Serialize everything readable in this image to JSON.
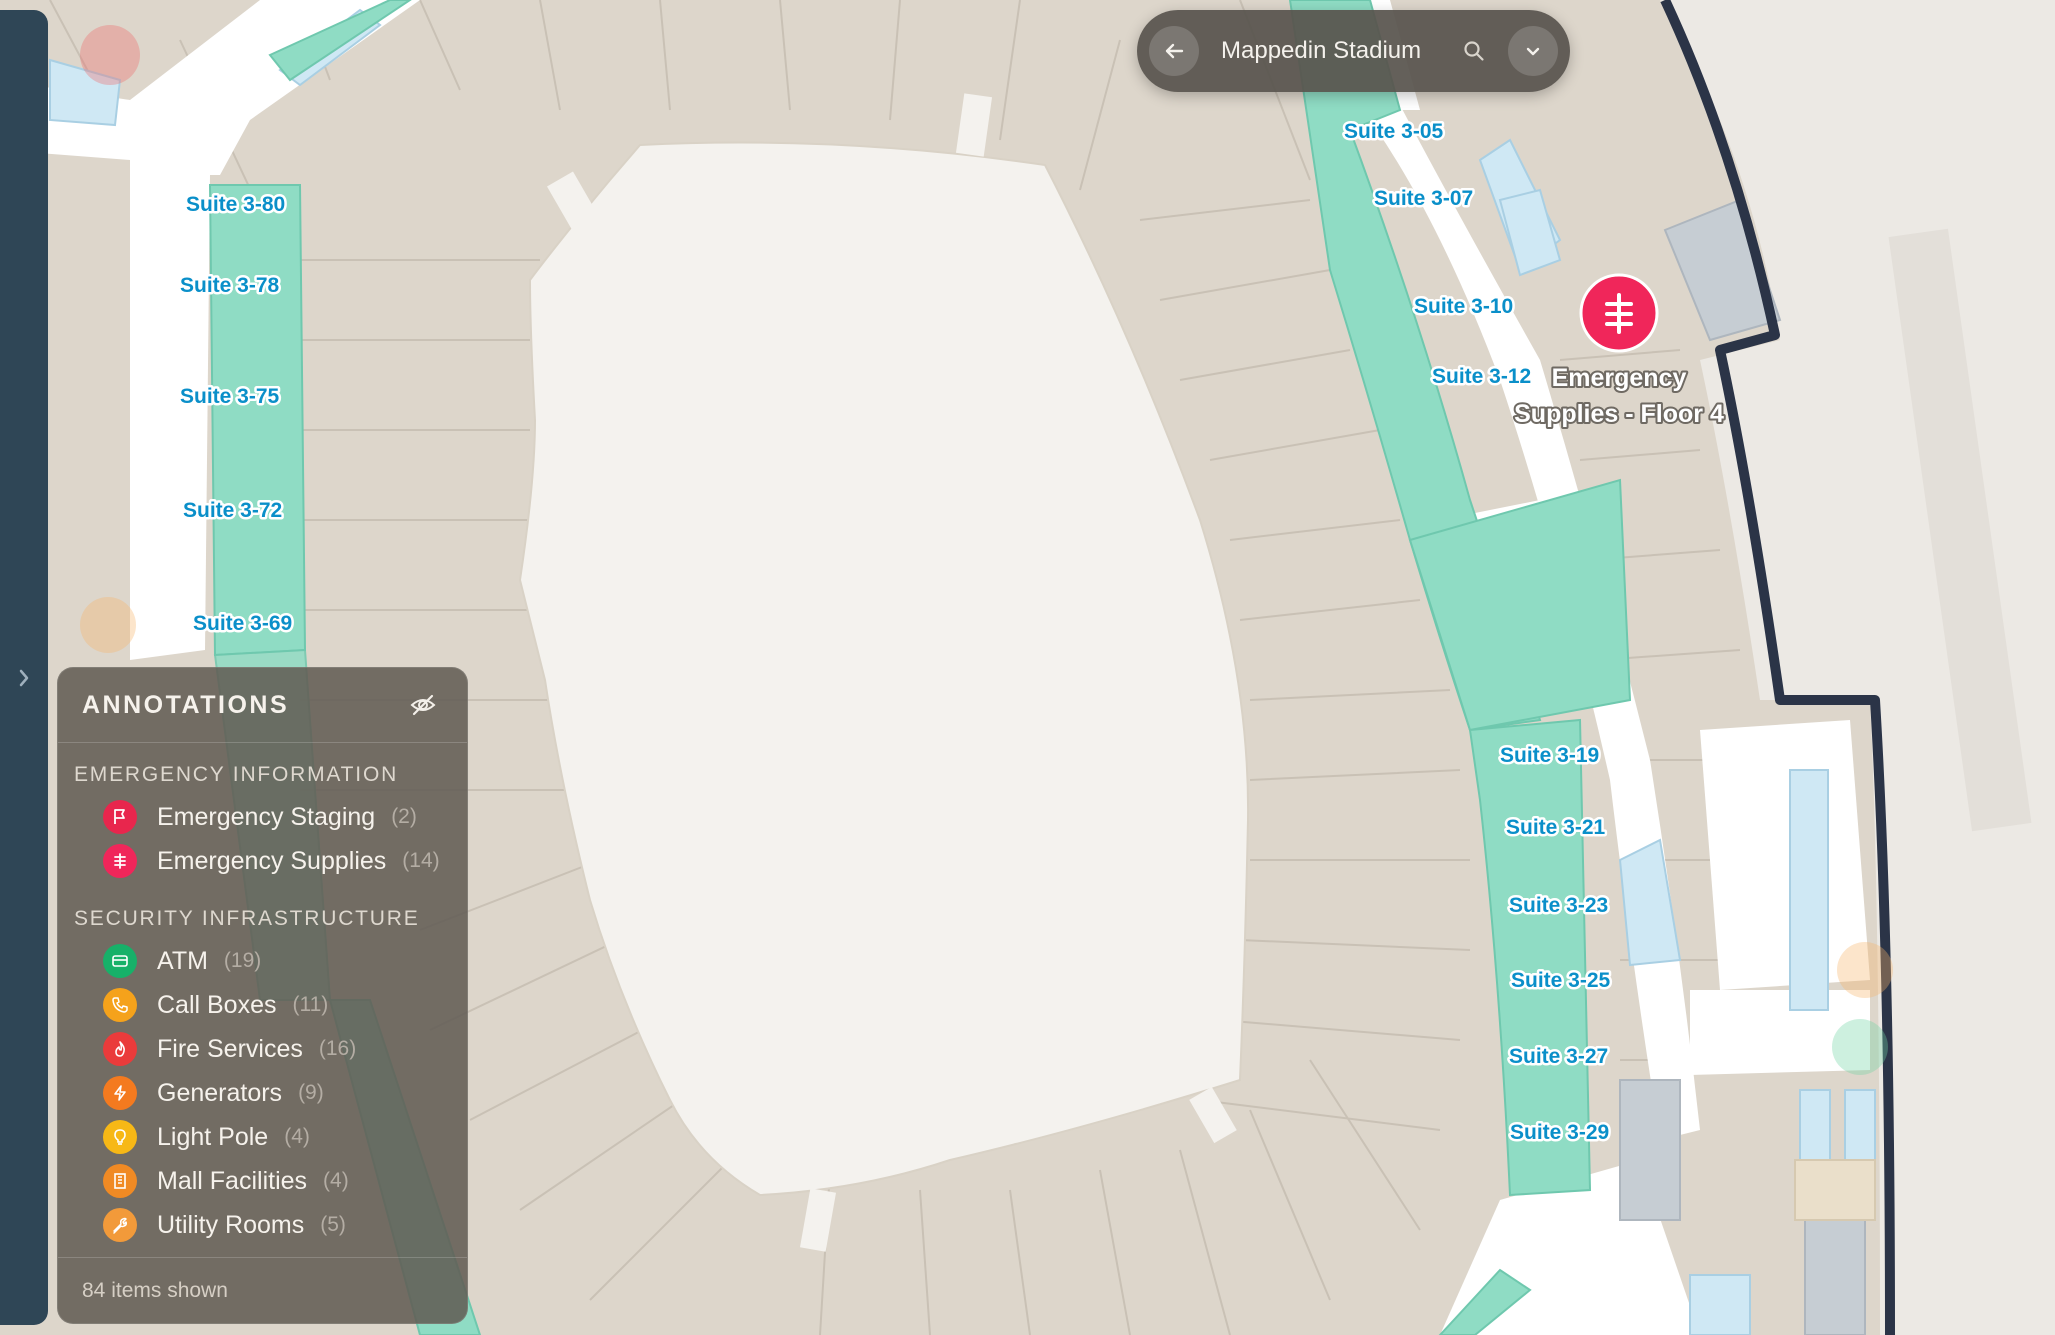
{
  "map": {
    "suites": [
      {
        "id": "s-3-80",
        "label": "Suite 3-80"
      },
      {
        "id": "s-3-78",
        "label": "Suite 3-78"
      },
      {
        "id": "s-3-75",
        "label": "Suite 3-75"
      },
      {
        "id": "s-3-72",
        "label": "Suite 3-72"
      },
      {
        "id": "s-3-69",
        "label": "Suite 3-69"
      },
      {
        "id": "s-3-05",
        "label": "Suite 3-05"
      },
      {
        "id": "s-3-07",
        "label": "Suite 3-07"
      },
      {
        "id": "s-3-10",
        "label": "Suite 3-10"
      },
      {
        "id": "s-3-12",
        "label": "Suite 3-12"
      },
      {
        "id": "s-3-19",
        "label": "Suite 3-19"
      },
      {
        "id": "s-3-21",
        "label": "Suite 3-21"
      },
      {
        "id": "s-3-23",
        "label": "Suite 3-23"
      },
      {
        "id": "s-3-25",
        "label": "Suite 3-25"
      },
      {
        "id": "s-3-27",
        "label": "Suite 3-27"
      },
      {
        "id": "s-3-29",
        "label": "Suite 3-29"
      }
    ],
    "selected_poi": {
      "label_line1": "Emergency",
      "label_line2": "Supplies - Floor 4",
      "icon": "emergency-supplies-icon",
      "color": "#f0265a"
    },
    "colors": {
      "concourse": "#ddd6cb",
      "field": "#f4f2ee",
      "corridor": "#ffffff",
      "suite_fill": "#8fdcc4",
      "outer_wall": "#2b3447"
    }
  },
  "top_bar": {
    "back_icon": "arrow-left-icon",
    "title": "Mappedin Stadium",
    "search_icon": "search-icon",
    "dropdown_icon": "chevron-down-icon"
  },
  "side_rail": {
    "toggle_icon": "chevron-right-icon"
  },
  "annotations": {
    "title": "ANNOTATIONS",
    "hide_icon": "eye-off-icon",
    "groups": [
      {
        "heading": "EMERGENCY INFORMATION",
        "items": [
          {
            "label": "Emergency Staging",
            "count": "(2)",
            "icon": "flag-icon",
            "color": "#e8264d"
          },
          {
            "label": "Emergency Supplies",
            "count": "(14)",
            "icon": "emergency-supplies-icon",
            "color": "#f0265a"
          }
        ]
      },
      {
        "heading": "SECURITY INFRASTRUCTURE",
        "items": [
          {
            "label": "ATM",
            "count": "(19)",
            "icon": "card-icon",
            "color": "#17b169"
          },
          {
            "label": "Call Boxes",
            "count": "(11)",
            "icon": "phone-icon",
            "color": "#f5a21b"
          },
          {
            "label": "Fire Services",
            "count": "(16)",
            "icon": "flame-icon",
            "color": "#ea3b3b"
          },
          {
            "label": "Generators",
            "count": "(9)",
            "icon": "bolt-icon",
            "color": "#f47a1f"
          },
          {
            "label": "Light Pole",
            "count": "(4)",
            "icon": "bulb-icon",
            "color": "#f7b816"
          },
          {
            "label": "Mall Facilities",
            "count": "(4)",
            "icon": "building-icon",
            "color": "#f08a24"
          },
          {
            "label": "Utility Rooms",
            "count": "(5)",
            "icon": "wrench-icon",
            "color": "#f29a3a"
          }
        ]
      }
    ],
    "footer": "84 items shown"
  }
}
